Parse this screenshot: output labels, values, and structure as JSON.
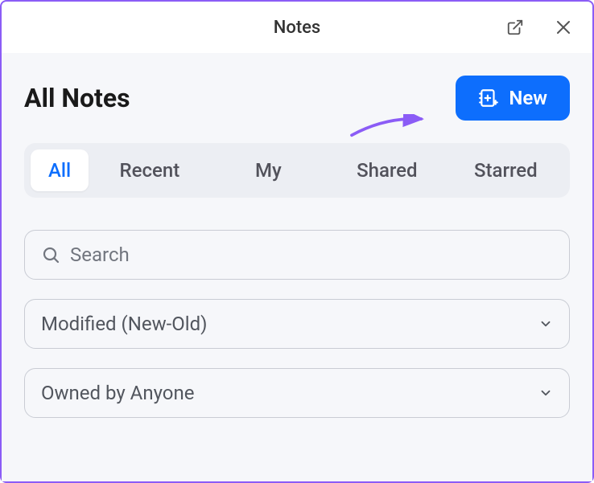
{
  "titlebar": {
    "title": "Notes"
  },
  "header": {
    "page_title": "All Notes",
    "new_button_label": "New"
  },
  "tabs": {
    "items": [
      {
        "label": "All",
        "active": true
      },
      {
        "label": "Recent",
        "active": false
      },
      {
        "label": "My",
        "active": false
      },
      {
        "label": "Shared",
        "active": false
      },
      {
        "label": "Starred",
        "active": false
      }
    ]
  },
  "search": {
    "placeholder": "Search"
  },
  "sort_dropdown": {
    "selected": "Modified (New-Old)"
  },
  "owner_dropdown": {
    "selected": "Owned by Anyone"
  },
  "colors": {
    "accent": "#0d6efd",
    "annotation": "#8b5cf6"
  }
}
